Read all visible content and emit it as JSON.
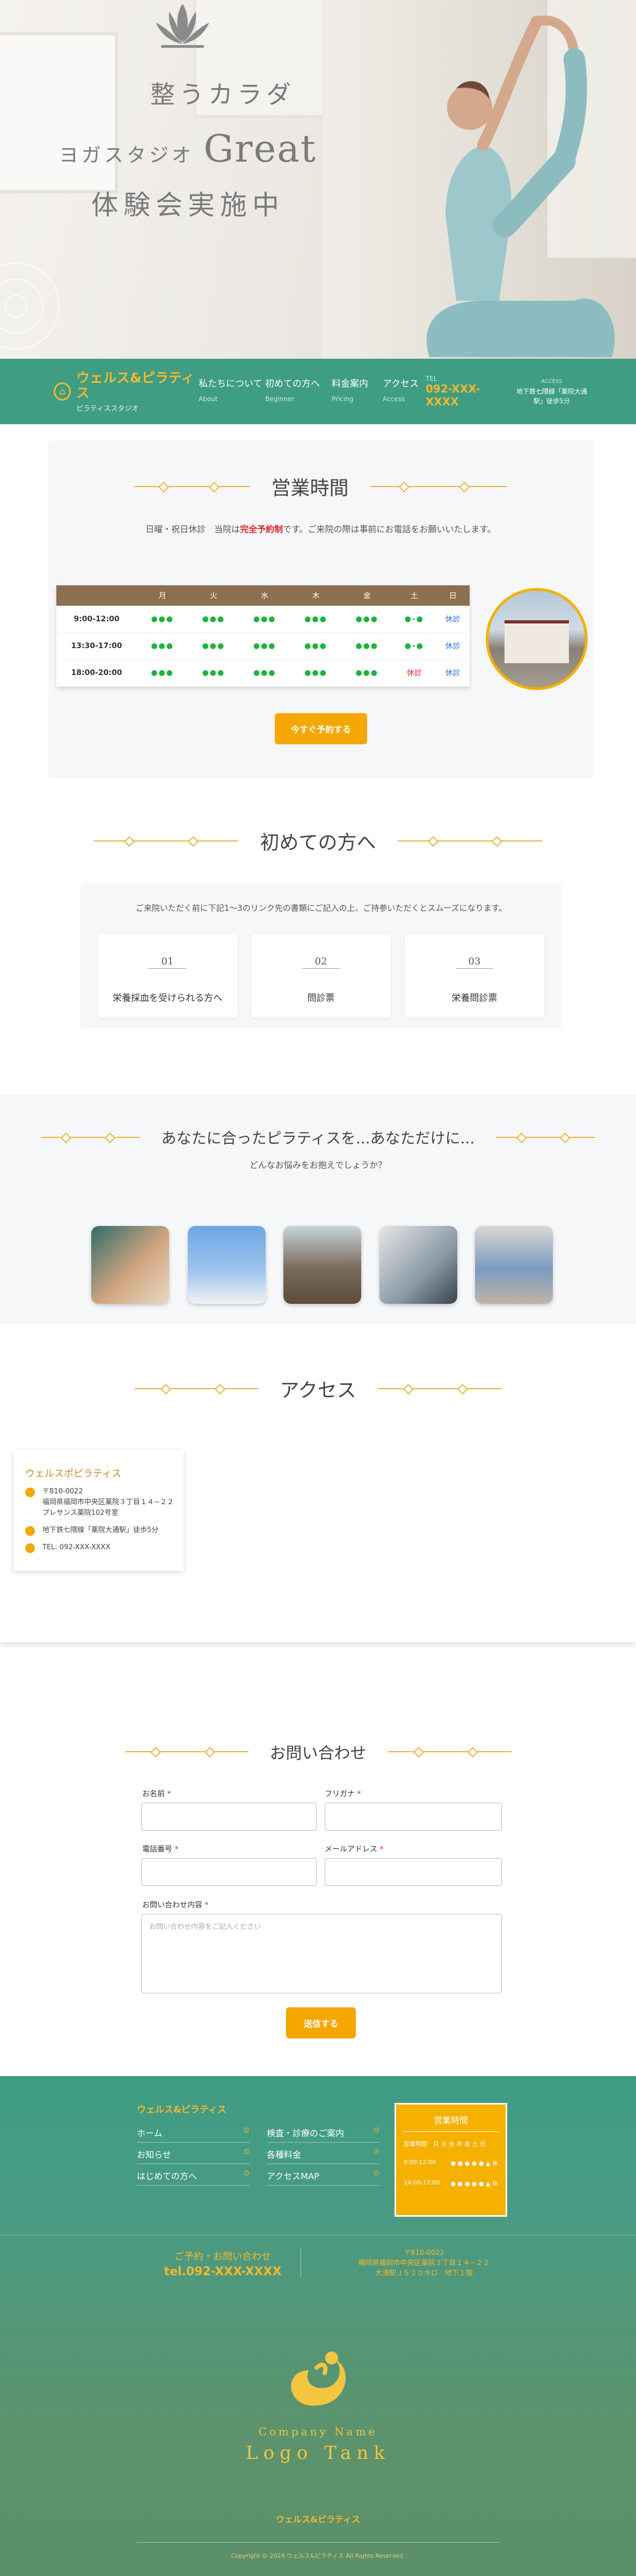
{
  "hero": {
    "line1": "整うカラダ",
    "line2_pre": "ヨガスタジオ",
    "line2_big": "Great",
    "line3": "体験会実施中"
  },
  "nav": {
    "brand": "ウェルス&ピラティス",
    "brand_sub": "ピラティススタジオ",
    "items": [
      {
        "label": "私たちについて",
        "sub": "About"
      },
      {
        "label": "初めての方へ",
        "sub": "Beginner"
      },
      {
        "label": "料金案内",
        "sub": "Pricing"
      },
      {
        "label": "アクセス",
        "sub": "Access"
      }
    ],
    "tel_label": "TEL",
    "tel": "092-XXX-XXXX",
    "access_label": "ACCESS",
    "access_text": "地下鉄七隈線「薬院大通駅」徒歩5分"
  },
  "hours": {
    "title": "営業時間",
    "note_pre": "日曜・祝日休診　当院は",
    "note_em": "完全予約制",
    "note_post": "です。ご来院の際は事前にお電話をお願いいたします。",
    "days": [
      "月",
      "火",
      "水",
      "木",
      "金",
      "土",
      "日"
    ],
    "rows": [
      {
        "time": "9:00-12:00",
        "cells": [
          "●●●",
          "●●●",
          "●●●",
          "●●●",
          "●●●",
          "●-●",
          "休診"
        ]
      },
      {
        "time": "13:30-17:00",
        "cells": [
          "●●●",
          "●●●",
          "●●●",
          "●●●",
          "●●●",
          "●-●",
          "休診"
        ]
      },
      {
        "time": "18:00-20:00",
        "cells": [
          "●●●",
          "●●●",
          "●●●",
          "●●●",
          "●●●",
          "休診",
          "休診"
        ]
      }
    ],
    "cta": "今すぐ予約する"
  },
  "first": {
    "title": "初めての方へ",
    "intro": "ご来院いただく前に下記1〜3のリンク先の書類にご記入の上、ご持参いただくとスムーズになります。",
    "cards": [
      {
        "num": "01",
        "label": "栄養採血を受けられる方へ"
      },
      {
        "num": "02",
        "label": "問診票"
      },
      {
        "num": "03",
        "label": "栄養問診票"
      }
    ]
  },
  "pilates": {
    "title": "あなたに合ったピラティスを...あなただけに...",
    "sub": "どんなお悩みをお抱えでしょうか？"
  },
  "access": {
    "title": "アクセス",
    "card_title": "ウェルスポピラティス",
    "address": "〒810-0022\n福岡県福岡市中央区薬院３丁目１４−２２\nプレサンス薬院102号室",
    "station": "地下鉄七隈線「薬院大通駅」徒歩5分",
    "tel": "TEL: 092-XXX-XXXX"
  },
  "contact": {
    "title": "お問い合わせ",
    "name_label": "お名前",
    "kana_label": "フリガナ",
    "phone_label": "電話番号",
    "email_label": "メールアドレス",
    "message_label": "お問い合わせ内容",
    "message_placeholder": "お問い合わせ内容をご記入ください",
    "submit": "送信する"
  },
  "footer": {
    "brand": "ウェルス&ピラティス",
    "links_left": [
      "ホーム",
      "お知らせ",
      "はじめての方へ"
    ],
    "links_right": [
      "検査・診療のご案内",
      "各種料金",
      "アクセスMAP"
    ],
    "hours_title": "営業時間",
    "hours_head": "営業時間　月 火 水 木 金 土 日",
    "hours_r1": "9:00-12:00",
    "hours_r2": "14:00-17:00",
    "cta_label": "ご予約・お問い合わせ",
    "cta_tel": "tel.092-XXX-XXXX",
    "addr": "〒810-0022\n福岡県福岡市中央区薬院３丁目１４−２２\n大濠駅Ｊ５２０キロ　地下１階",
    "company": "Company Name",
    "logo": "Logo Tank",
    "brand2": "ウェルス&ピラティス",
    "copyright": "Copyright © 2024 ウェルス&ピラティス All Rights Reserved."
  }
}
